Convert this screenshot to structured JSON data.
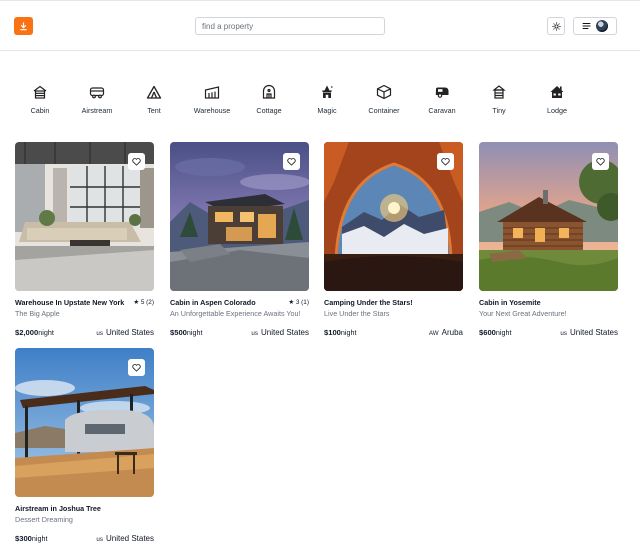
{
  "header": {
    "search_placeholder": "find a property"
  },
  "categories": [
    {
      "label": "Cabin",
      "icon": "cabin-icon"
    },
    {
      "label": "Airstream",
      "icon": "airstream-icon"
    },
    {
      "label": "Tent",
      "icon": "tent-icon"
    },
    {
      "label": "Warehouse",
      "icon": "warehouse-icon"
    },
    {
      "label": "Cottage",
      "icon": "cottage-icon"
    },
    {
      "label": "Magic",
      "icon": "magic-icon"
    },
    {
      "label": "Container",
      "icon": "container-icon"
    },
    {
      "label": "Caravan",
      "icon": "caravan-icon"
    },
    {
      "label": "Tiny",
      "icon": "tiny-icon"
    },
    {
      "label": "Lodge",
      "icon": "lodge-icon"
    }
  ],
  "listings": [
    {
      "title": "Warehouse In Upstate New York",
      "rating": "★ 5 (2)",
      "subtitle": "The Big Apple",
      "price": "$2,000",
      "per": "night",
      "country_code": "us",
      "country": "United States"
    },
    {
      "title": "Cabin in Aspen Colorado",
      "rating": "★ 3 (1)",
      "subtitle": "An Unforgettable Experience Awaits You!",
      "price": "$500",
      "per": "night",
      "country_code": "us",
      "country": "United States"
    },
    {
      "title": "Camping Under the Stars!",
      "rating": "",
      "subtitle": "Live Under the Stars",
      "price": "$100",
      "per": "night",
      "country_code": "AW",
      "country": "Aruba"
    },
    {
      "title": "Cabin in Yosemite",
      "rating": "",
      "subtitle": "Your Next Great Adventure!",
      "price": "$600",
      "per": "night",
      "country_code": "us",
      "country": "United States"
    },
    {
      "title": "Airstream in Joshua Tree",
      "rating": "",
      "subtitle": "Dessert Dreaming",
      "price": "$300",
      "per": "night",
      "country_code": "us",
      "country": "United States"
    }
  ],
  "colors": {
    "accent": "#f97316",
    "border": "#e5e7eb",
    "muted_text": "#6b7280"
  }
}
